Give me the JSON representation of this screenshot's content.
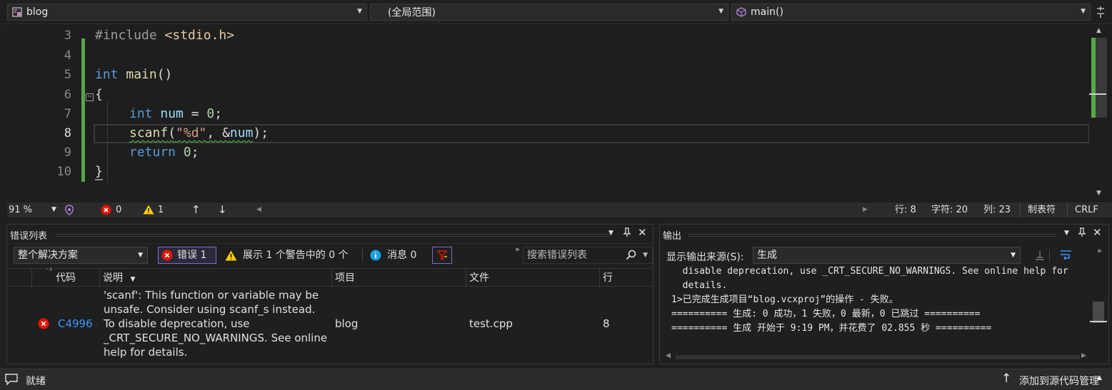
{
  "nav": {
    "project": "blog",
    "scope": "(全局范围)",
    "member": "main()"
  },
  "editor": {
    "line_numbers": [
      "3",
      "4",
      "5",
      "6",
      "7",
      "8",
      "9",
      "10"
    ],
    "code": {
      "l3_directive": "#include",
      "l3_file": "<stdio.h>",
      "l5_type": "int",
      "l5_name": "main",
      "l5_rest": "()",
      "l6": "{",
      "l7_type": "int",
      "l7_var": "num",
      "l7_eq": " = ",
      "l7_num": "0",
      "l7_end": ";",
      "l8_fn": "scanf",
      "l8_open": "(",
      "l8_str": "\"%d\"",
      "l8_mid": ", &",
      "l8_var": "num",
      "l8_end": ");",
      "l9_kw": "return",
      "l9_num": "0",
      "l9_end": ";",
      "l10": "}"
    }
  },
  "edstatus": {
    "zoom": "91 %",
    "errors": "0",
    "warnings": "1",
    "line": "行: 8",
    "char": "字符: 20",
    "col": "列: 23",
    "tabs": "制表符",
    "eol": "CRLF"
  },
  "errorlist": {
    "title": "错误列表",
    "scope": "整个解决方案",
    "errors_filter": "错误 1",
    "warnings_filter": "展示 1 个警告中的 0 个",
    "messages_filter": "消息 0",
    "search_placeholder": "搜索错误列表",
    "columns": [
      "代码",
      "说明",
      "项目",
      "文件",
      "行"
    ],
    "row": {
      "code": "C4996",
      "desc": "'scanf': This function or variable may be unsafe. Consider using scanf_s instead. To disable deprecation, use _CRT_SECURE_NO_WARNINGS. See online help for details.",
      "project": "blog",
      "file": "test.cpp",
      "line": "8"
    }
  },
  "output": {
    "title": "输出",
    "source_label": "显示输出来源(S):",
    "source_value": "生成",
    "lines": [
      "  disable deprecation, use _CRT_SECURE_NO_WARNINGS. See online help for",
      "  details.",
      "1>已完成生成项目“blog.vcxproj”的操作 - 失败。",
      "========== 生成: 0 成功，1 失败，0 最新，0 已跳过 ==========",
      "========== 生成 开始于 9:19 PM，并花费了 02.855 秒 =========="
    ]
  },
  "statusbar": {
    "ready": "就绪",
    "source_control": "添加到源代码管理"
  },
  "colors": {
    "keyword": "#569cd6",
    "function": "#dcdcaa",
    "string": "#d69d85",
    "number": "#b5cea8",
    "variable": "#9cdcfe",
    "change_bar": "#57a64a",
    "error": "#e51400",
    "warning": "#ffcc00",
    "info": "#1ba1e2",
    "link": "#3794ff"
  }
}
